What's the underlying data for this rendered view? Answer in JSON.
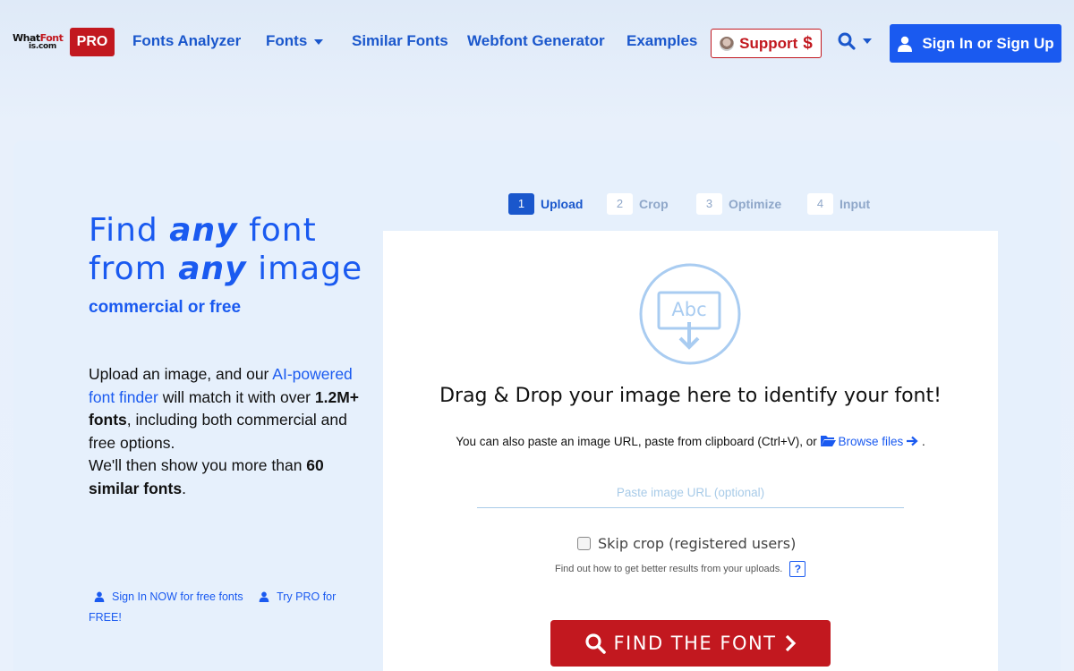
{
  "header": {
    "logo_line1_a": "What",
    "logo_line1_b": "Font",
    "logo_line2": "is.com",
    "pro_badge": "PRO",
    "nav": [
      {
        "label": "Fonts Analyzer"
      },
      {
        "label": "Fonts"
      },
      {
        "label": "Similar Fonts"
      },
      {
        "label": "Webfont Generator"
      },
      {
        "label": "Examples"
      }
    ],
    "support_label": "Support",
    "support_symbol": "$",
    "signin_label": "Sign In or Sign Up"
  },
  "hero": {
    "title_w1": "Find",
    "title_w2": "any",
    "title_w3": "font",
    "title_w4": "from",
    "title_w5": "any",
    "title_w6": "image",
    "subtitle": "commercial or free",
    "desc_p1": "Upload an image, and our ",
    "desc_link": "AI-powered font finder",
    "desc_p2": " will match it with over ",
    "desc_b1": "1.2M+ fonts",
    "desc_p3": ", including both commercial and free options.",
    "desc_p4": "We'll then show you more than ",
    "desc_b2": "60 similar fonts",
    "desc_p5": ".",
    "signin_link": "Sign In NOW for free fonts",
    "pro_link": "Try PRO for FREE!"
  },
  "steps": [
    {
      "num": "1",
      "label": "Upload"
    },
    {
      "num": "2",
      "label": "Crop"
    },
    {
      "num": "3",
      "label": "Optimize"
    },
    {
      "num": "4",
      "label": "Input"
    }
  ],
  "upload": {
    "icon_text": "Abc",
    "drop_title": "Drag & Drop your image here to identify your font!",
    "paste_note": "You can also paste an image URL, paste from clipboard (Ctrl+V), or ",
    "browse_label": "Browse files",
    "paste_note_end": " .",
    "url_placeholder": "Paste image URL (optional)",
    "skip_crop_label": "Skip crop (registered users)",
    "tips_text": "Find out how to get better results from your uploads.",
    "help_label": "?",
    "find_button": "FIND THE FONT"
  },
  "colors": {
    "brand_blue": "#1a5af0",
    "brand_red": "#c2181f"
  }
}
